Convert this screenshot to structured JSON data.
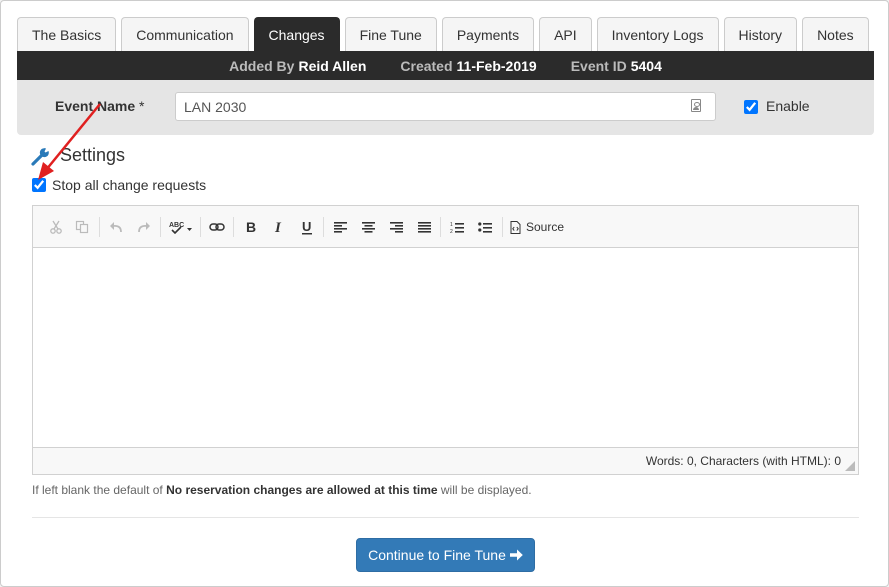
{
  "tabs": [
    {
      "label": "The Basics",
      "active": false
    },
    {
      "label": "Communication",
      "active": false
    },
    {
      "label": "Changes",
      "active": true
    },
    {
      "label": "Fine Tune",
      "active": false
    },
    {
      "label": "Payments",
      "active": false
    },
    {
      "label": "API",
      "active": false
    },
    {
      "label": "Inventory Logs",
      "active": false
    },
    {
      "label": "History",
      "active": false
    },
    {
      "label": "Notes",
      "active": false
    }
  ],
  "info_bar": {
    "added_by_label": "Added By",
    "added_by_value": "Reid Allen",
    "created_label": "Created",
    "created_value": "11-Feb-2019",
    "event_id_label": "Event ID",
    "event_id_value": "5404"
  },
  "event_name": {
    "label": "Event Name",
    "required_marker": "*",
    "value": "LAN 2030",
    "enable_label": "Enable",
    "enable_checked": true
  },
  "settings": {
    "title": "Settings",
    "stop_changes_label": "Stop all change requests",
    "stop_changes_checked": true
  },
  "editor": {
    "toolbar_icons": [
      "cut-icon",
      "copy-icon",
      "undo-icon",
      "redo-icon",
      "spellcheck-icon",
      "link-icon",
      "bold-icon",
      "italic-icon",
      "underline-icon",
      "align-left-icon",
      "align-center-icon",
      "align-right-icon",
      "justify-icon",
      "numbered-list-icon",
      "bullet-list-icon",
      "source-icon"
    ],
    "source_label": "Source",
    "word_count": "Words: 0, Characters (with HTML): 0"
  },
  "help": {
    "prefix": "If left blank the default of",
    "default_text": "No reservation changes are allowed at this time",
    "suffix": "will be displayed."
  },
  "continue_button": {
    "label": "Continue to Fine Tune"
  },
  "colors": {
    "accent": "#337ab7",
    "dark_bar": "#2b2b2b",
    "annotation_arrow": "#e02020",
    "wrench": "#2a7ab9"
  }
}
